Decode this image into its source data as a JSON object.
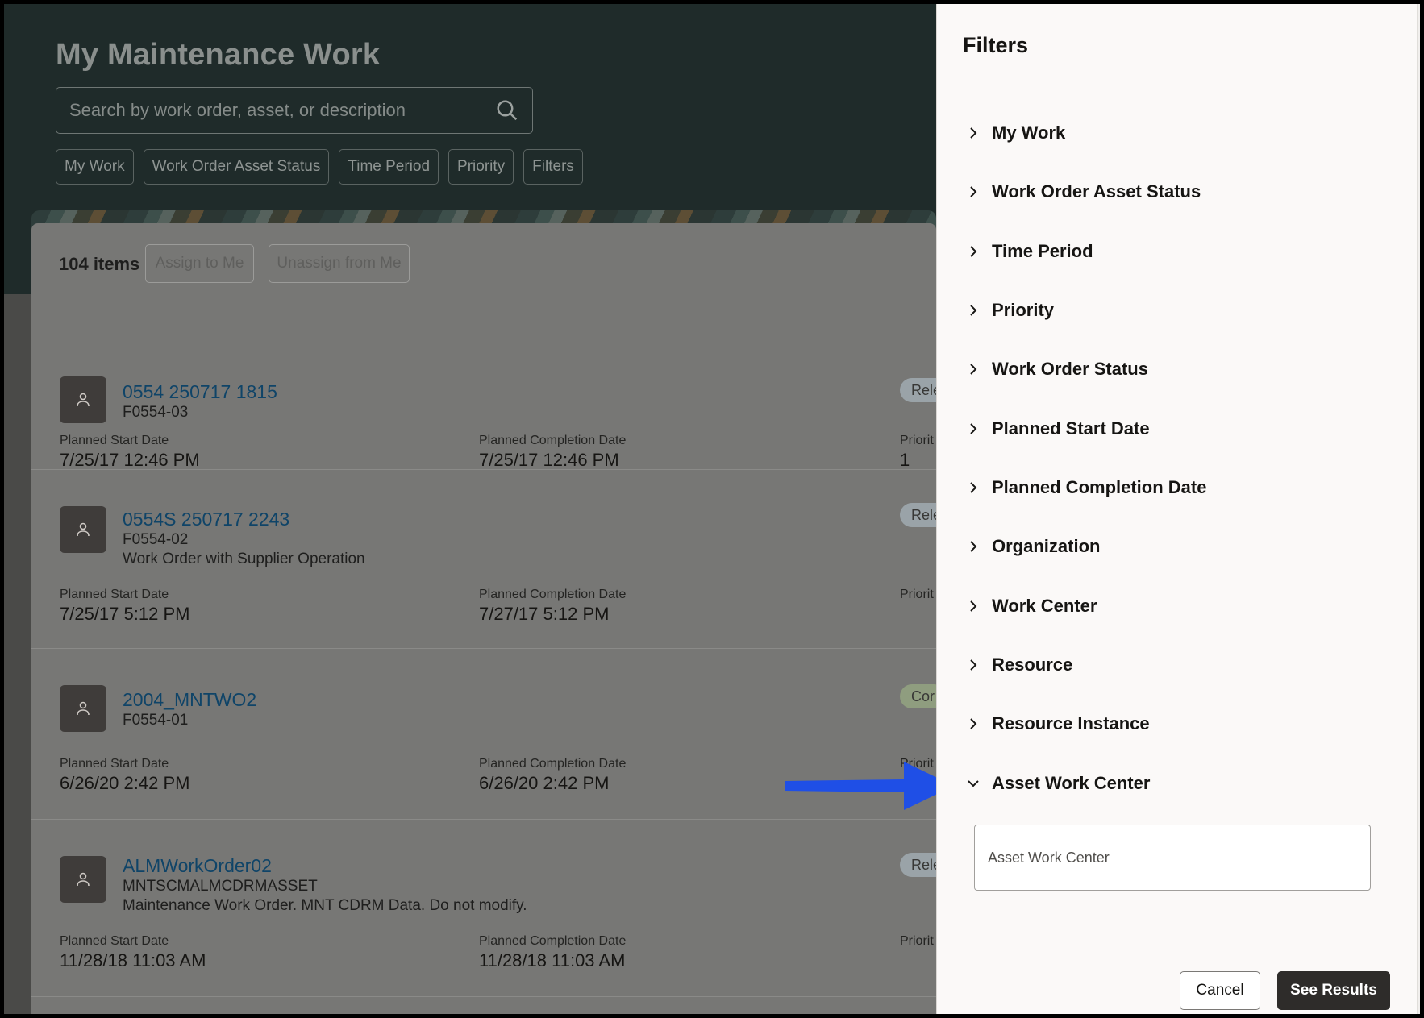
{
  "page": {
    "title": "My Maintenance Work",
    "search_placeholder": "Search by work order, asset, or description",
    "chips": [
      "My Work",
      "Work Order Asset Status",
      "Time Period",
      "Priority",
      "Filters"
    ],
    "item_count": "104 items",
    "assign_label": "Assign to Me",
    "unassign_label": "Unassign from Me"
  },
  "work_orders": [
    {
      "number": "0554 250717 1815",
      "asset": "F0554-03",
      "description": "",
      "start_label": "Planned Start Date",
      "start": "7/25/17 12:46 PM",
      "completion_label": "Planned Completion Date",
      "completion": "7/25/17 12:46 PM",
      "priority_label": "Priorit",
      "priority": "1",
      "status": "Rele",
      "status_color": "#9aa3a8"
    },
    {
      "number": "0554S 250717 2243",
      "asset": "F0554-02",
      "description": "Work Order with Supplier Operation",
      "start_label": "Planned Start Date",
      "start": "7/25/17 5:12 PM",
      "completion_label": "Planned Completion Date",
      "completion": "7/27/17 5:12 PM",
      "priority_label": "Priorit",
      "priority": "",
      "status": "Rele",
      "status_color": "#9aa3a8"
    },
    {
      "number": "2004_MNTWO2",
      "asset": "F0554-01",
      "description": "",
      "start_label": "Planned Start Date",
      "start": "6/26/20 2:42 PM",
      "completion_label": "Planned Completion Date",
      "completion": "6/26/20 2:42 PM",
      "priority_label": "Priorit",
      "priority": "",
      "status": "Cor",
      "status_color": "#8f9d7f"
    },
    {
      "number": "ALMWorkOrder02",
      "asset": "MNTSCMALMCDRMASSET",
      "description": "Maintenance Work Order. MNT CDRM Data. Do not modify.",
      "start_label": "Planned Start Date",
      "start": "11/28/18 11:03 AM",
      "completion_label": "Planned Completion Date",
      "completion": "11/28/18 11:03 AM",
      "priority_label": "Priorit",
      "priority": "",
      "status": "Rele",
      "status_color": "#9aa3a8"
    }
  ],
  "drawer": {
    "title": "Filters",
    "filters": [
      {
        "label": "My Work",
        "expanded": false
      },
      {
        "label": "Work Order Asset Status",
        "expanded": false
      },
      {
        "label": "Time Period",
        "expanded": false
      },
      {
        "label": "Priority",
        "expanded": false
      },
      {
        "label": "Work Order Status",
        "expanded": false
      },
      {
        "label": "Planned Start Date",
        "expanded": false
      },
      {
        "label": "Planned Completion Date",
        "expanded": false
      },
      {
        "label": "Organization",
        "expanded": false
      },
      {
        "label": "Work Center",
        "expanded": false
      },
      {
        "label": "Resource",
        "expanded": false
      },
      {
        "label": "Resource Instance",
        "expanded": false
      },
      {
        "label": "Asset Work Center",
        "expanded": true
      }
    ],
    "asset_work_center_placeholder": "Asset Work Center",
    "cancel_label": "Cancel",
    "see_results_label": "See Results"
  },
  "colors": {
    "hero_bg": "#1f2b2a",
    "overlay_panel": "#777775",
    "link": "#0f4468",
    "primary_button": "#2e2c2a",
    "callout_arrow": "#1f4fe6"
  },
  "icons": {
    "search": "search-icon",
    "avatar": "person-icon",
    "collapsed": "chevron-right-icon",
    "expanded": "chevron-down-icon",
    "callout": "arrow-right-icon"
  }
}
